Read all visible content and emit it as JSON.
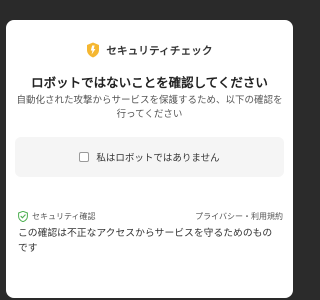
{
  "header": {
    "title": "セキュリティチェック",
    "icon": "shield-icon",
    "icon_color": "#f5b731"
  },
  "main": {
    "headline": "ロボットではないことを確認してください",
    "description": "自動化された攻撃からサービスを保護するため、以下の確認を行ってください"
  },
  "checkbox": {
    "label": "私はロボットではありません",
    "checked": false
  },
  "footer": {
    "security_label": "セキュリティ確認",
    "security_icon": "shield-check-icon",
    "security_icon_color": "#4caf50",
    "links": "プライバシー・利用規約",
    "note": "この確認は不正なアクセスからサービスを守るためのものです"
  }
}
